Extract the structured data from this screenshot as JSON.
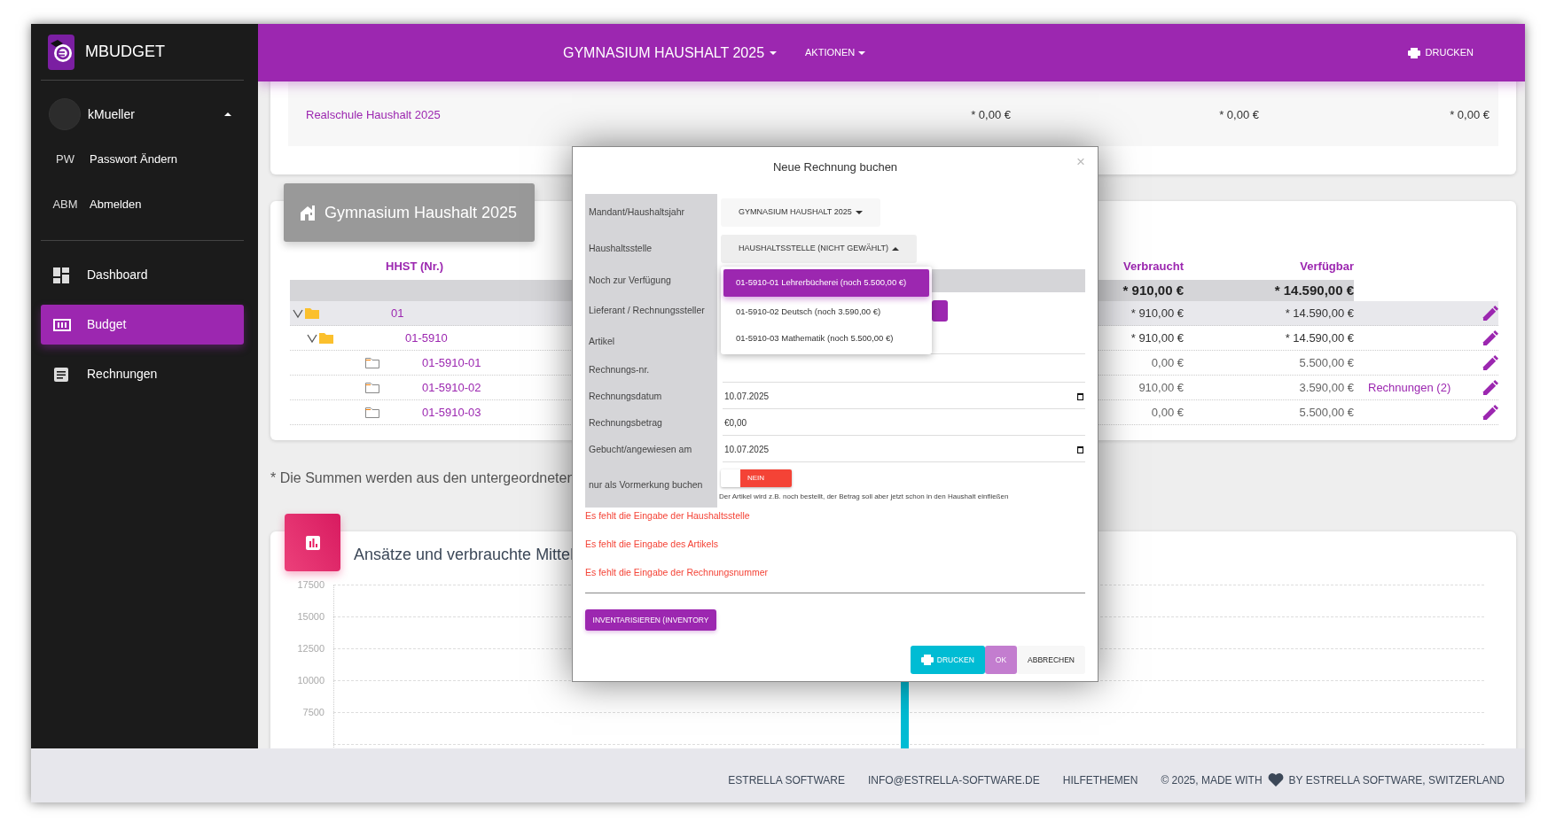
{
  "app": {
    "name": "MBUDGET"
  },
  "user": {
    "name": "kMueller",
    "expanded": true
  },
  "user_menu": [
    {
      "abbr": "PW",
      "label": "Passwort Ändern"
    },
    {
      "abbr": "ABM",
      "label": "Abmelden"
    }
  ],
  "nav": [
    {
      "label": "Dashboard",
      "selected": false
    },
    {
      "label": "Budget",
      "selected": true
    },
    {
      "label": "Rechnungen",
      "selected": false
    }
  ],
  "header": {
    "title": "GYMNASIUM HAUSHALT 2025",
    "menu": "AKTIONEN",
    "print": "DRUCKEN"
  },
  "other_budget": {
    "name": "Realschule Haushalt 2025",
    "values": [
      "* 0,00 €",
      "* 0,00 €",
      "* 0,00 €"
    ]
  },
  "budget": {
    "title": "Gymnasium Haushalt 2025",
    "columns": [
      "HHST (Nr.)",
      "Verbraucht",
      "Verfügbar"
    ],
    "total": {
      "verbraucht": "* 910,00 €",
      "verfuegbar": "* 14.590,00 €"
    },
    "rows": [
      {
        "number": "01",
        "verbraucht": "* 910,00 €",
        "verfuegbar": "* 14.590,00 €",
        "selected": true,
        "expanded": true,
        "children": [
          {
            "number": "01-5910",
            "verbraucht": "* 910,00 €",
            "verfuegbar": "* 14.590,00 €",
            "selected": false,
            "expanded": true,
            "children": [
              {
                "number": "01-5910-01",
                "verbraucht": "0,00 €",
                "verfuegbar": "5.500,00 €",
                "selected": false
              },
              {
                "number": "01-5910-02",
                "verbraucht": "910,00 €",
                "verfuegbar": "3.590,00 €",
                "link": "Rechnungen (2)",
                "selected": false
              },
              {
                "number": "01-5910-03",
                "verbraucht": "0,00 €",
                "verfuegbar": "5.500,00 €",
                "selected": false
              }
            ]
          }
        ]
      }
    ]
  },
  "note": "* Die Summen werden aus den untergeordneten",
  "chart": {
    "title": "Ansätze und verbrauchte Mittel",
    "yticks": [
      "17500",
      "15000",
      "12500",
      "10000",
      "7500"
    ]
  },
  "dialog": {
    "title": "Neue Rechnung buchen",
    "close": "×",
    "fields": [
      {
        "label": "Mandant/Haushaltsjahr",
        "kind": "dropdown",
        "value": "GYMNASIUM HAUSHALT 2025",
        "expanded": false
      },
      {
        "label": "Haushaltsstelle",
        "kind": "dropdown",
        "value": "HAUSHALTSSTELLE (NICHT GEWÄHLT)",
        "expanded": true,
        "options": [
          {
            "label": "01-5910-01 Lehrerbücherei (noch 5.500,00 €)",
            "selected": true
          },
          {
            "label": "01-5910-02 Deutsch (noch 3.590,00 €)",
            "selected": false
          },
          {
            "label": "01-5910-03 Mathematik (noch 5.500,00 €)",
            "selected": false
          }
        ]
      },
      {
        "label": "Noch zur Verfügung",
        "kind": "display"
      },
      {
        "label": "Lieferant / Rechnungssteller",
        "kind": "add"
      },
      {
        "label": "Artikel",
        "kind": "text"
      },
      {
        "label": "Rechnungs-nr.",
        "kind": "text"
      },
      {
        "label": "Rechnungsdatum",
        "kind": "date",
        "value": "10.07.2025"
      },
      {
        "label": "Rechnungsbetrag",
        "kind": "text",
        "value": "€0,00"
      },
      {
        "label": "Gebucht/angewiesen am",
        "kind": "date",
        "value": "10.07.2025"
      },
      {
        "label": "nur als Vormerkung buchen",
        "kind": "toggle",
        "on": false,
        "value": "NEIN",
        "hint": "Der Artikel wird z.B. noch bestellt, der Betrag soll aber jetzt schon in den Haushalt einfließen"
      }
    ],
    "errors": [
      "Es fehlt die Eingabe der Haushaltsstelle",
      "Es fehlt die Eingabe des Artikels",
      "Es fehlt die Eingabe der Rechnungsnummer"
    ],
    "inventory_button": "INVENTARISIEREN (INVENTORY",
    "buttons": [
      {
        "label": "DRUCKEN",
        "kind": "print",
        "disabled": false
      },
      {
        "label": "OK",
        "kind": "primary",
        "disabled": true
      },
      {
        "label": "ABBRECHEN",
        "kind": "cancel",
        "disabled": false
      }
    ]
  },
  "footer": {
    "links": [
      "ESTRELLA SOFTWARE",
      "INFO@ESTRELLA-SOFTWARE.DE",
      "HILFETHEMEN"
    ],
    "credit_before": "© 2025, MADE WITH",
    "credit_after": "BY ESTRELLA SOFTWARE, SWITZERLAND"
  }
}
